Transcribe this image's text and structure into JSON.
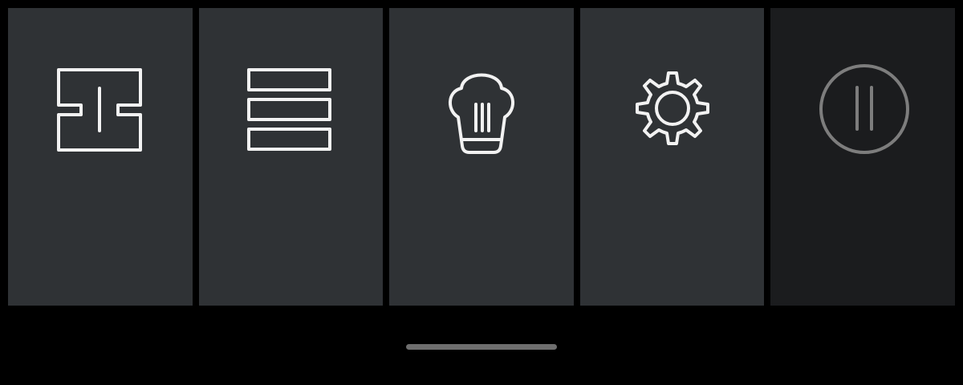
{
  "tiles": [
    {
      "id": "split",
      "icon": "split-layout-icon",
      "background": "#2f3235",
      "active": true
    },
    {
      "id": "list",
      "icon": "list-stack-icon",
      "background": "#2f3235",
      "active": true
    },
    {
      "id": "chef",
      "icon": "chef-hat-icon",
      "background": "#2f3235",
      "active": true
    },
    {
      "id": "settings",
      "icon": "gear-icon",
      "background": "#2f3235",
      "active": true
    },
    {
      "id": "pause",
      "icon": "pause-circle-icon",
      "background": "#1b1c1e",
      "active": false
    }
  ],
  "colors": {
    "screen_background": "#000000",
    "tile_background": "#2f3235",
    "tile_background_dim": "#1b1c1e",
    "icon_stroke": "#f2f2f2",
    "icon_stroke_dim": "#7d7d7d",
    "home_indicator": "#6e6e6e"
  }
}
